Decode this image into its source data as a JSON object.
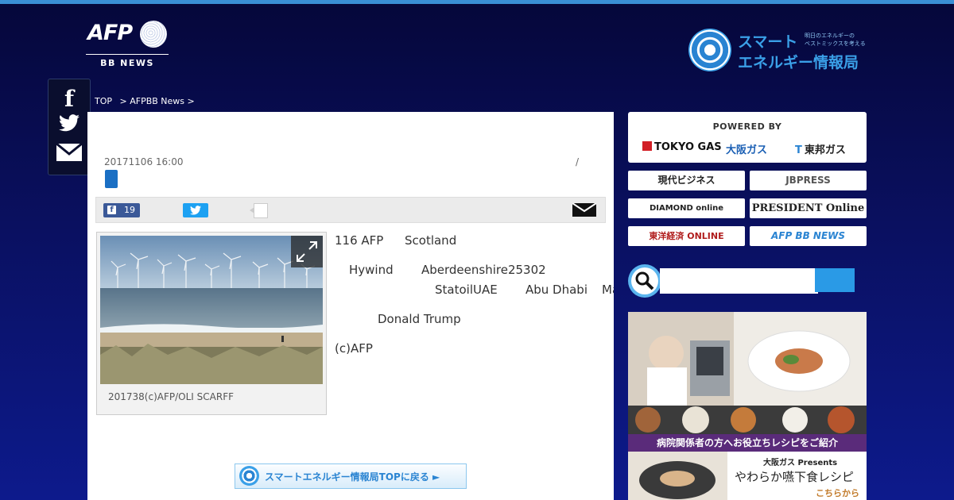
{
  "header": {
    "afp_logo_text": "AFP",
    "afp_logo_sub": "BB NEWS",
    "smart_energy_line1": "スマート",
    "smart_energy_line2": "エネルギー情報局",
    "smart_energy_tag1": "明日のエネルギーの",
    "smart_energy_tag2": "ベストミックスを考える"
  },
  "social": {
    "facebook_icon": "facebook-icon",
    "twitter_icon": "twitter-icon",
    "mail_icon": "mail-icon"
  },
  "breadcrumb": [
    "TOP",
    "> AFPBB News >"
  ],
  "article": {
    "date": "20171106 16:00",
    "slash": "/",
    "share": {
      "facebook_count": "19"
    },
    "photo_caption": "201738(c)AFP/OLI SCARFF",
    "body": {
      "p1_a": "116 AFP",
      "p1_b": "Scotland",
      "p2_a": "Hywind",
      "p2_b": "Aberdeenshire25302",
      "p2_c": "StatoilUAE",
      "p2_d": "Abu Dhabi",
      "p2_e": "Mas",
      "p3": "Donald Trump",
      "p4": "(c)AFP"
    },
    "back_button": "スマートエネルギー情報局TOPに戻る ►"
  },
  "sidebar": {
    "powered_by": "POWERED BY",
    "sponsors": [
      "TOKYO GAS",
      "大阪ガス",
      "東邦ガス"
    ],
    "media": [
      "現代ビジネス",
      "JBPRESS",
      "DIAMOND online",
      "PRESIDENT Online",
      "東洋経済 ONLINE",
      "AFP BB NEWS"
    ],
    "search_placeholder": "",
    "ad": {
      "banner": "病院関係者の方へお役立ちレシピをご紹介",
      "presents": "大阪ガス Presents",
      "title": "やわらか嚥下食レシピ",
      "cta": "こちらから"
    }
  },
  "colors": {
    "accent": "#2a9ae6",
    "background": "#0a1060",
    "facebook": "#3b5998",
    "twitter": "#1da1f2"
  }
}
